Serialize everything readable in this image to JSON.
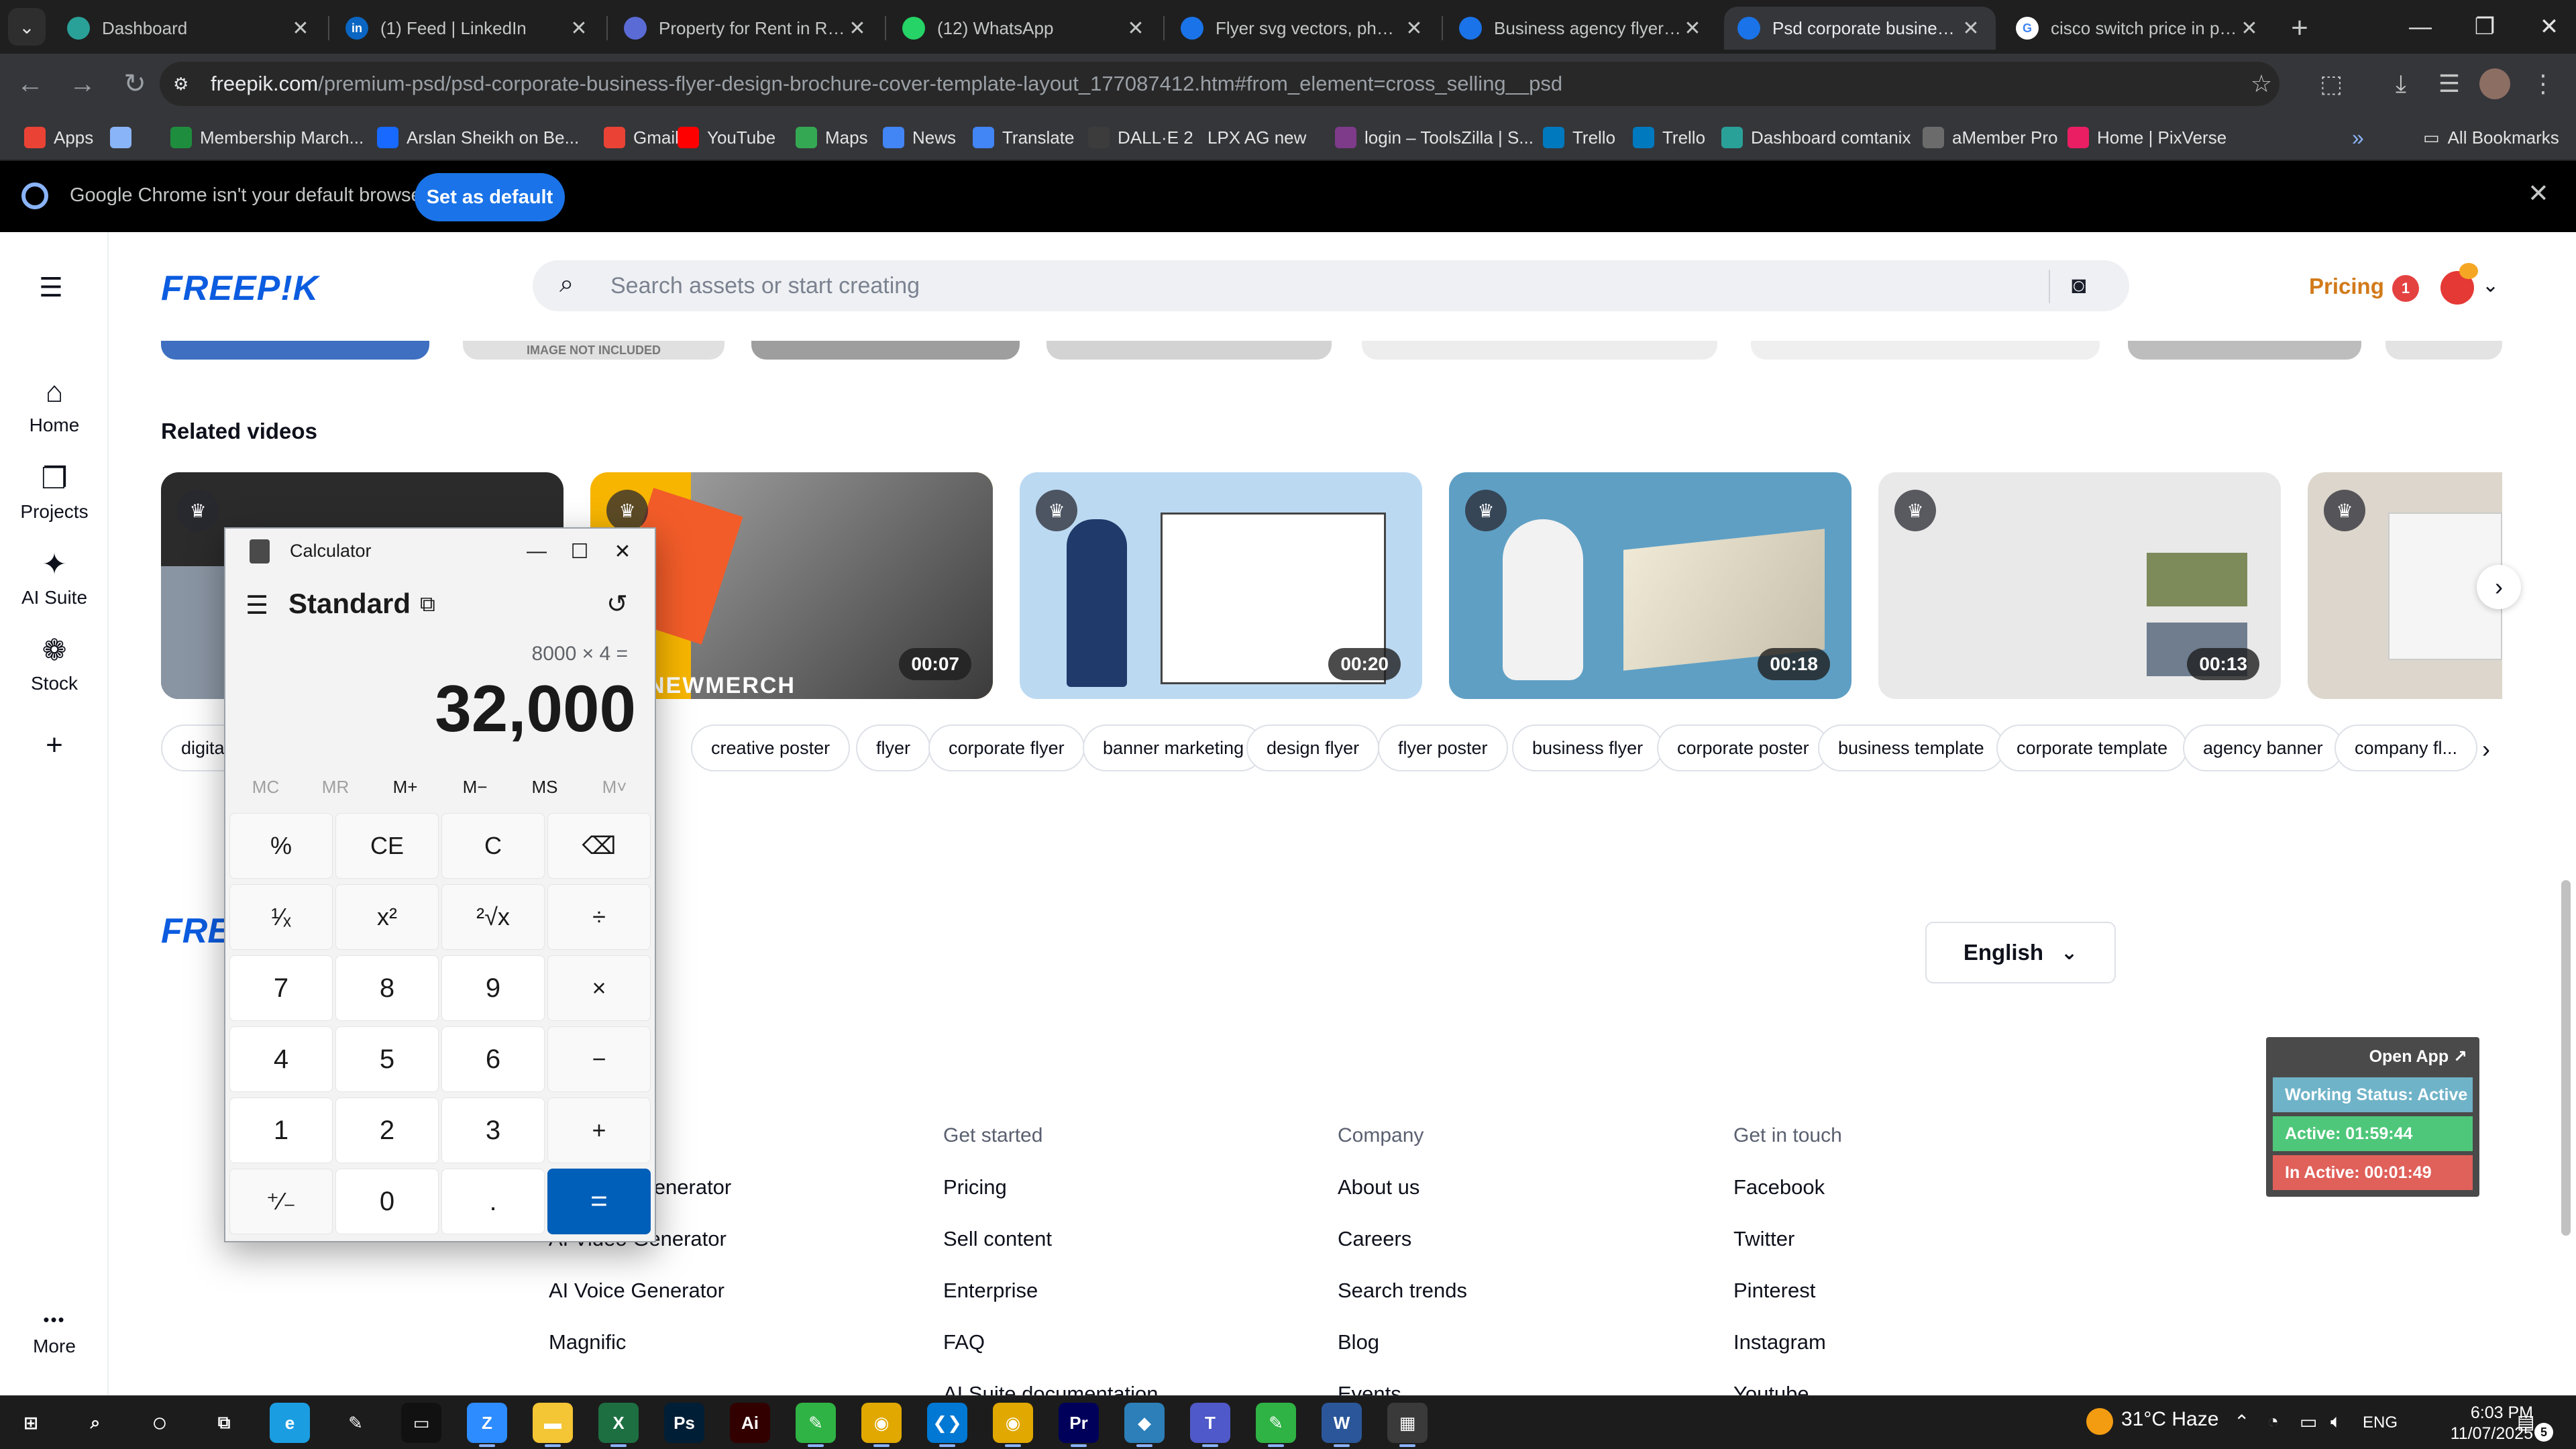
{
  "tabs": [
    {
      "title": "Dashboard",
      "favicon": "globe-icon",
      "color": "#2aa198",
      "active": false
    },
    {
      "title": "(1) Feed | LinkedIn",
      "favicon": "linkedin-icon",
      "color": "#0a66c2",
      "active": false
    },
    {
      "title": "Property for Rent in Rawa...",
      "favicon": "zameen-icon",
      "color": "#5b6bd6",
      "active": false
    },
    {
      "title": "(12) WhatsApp",
      "favicon": "whatsapp-icon",
      "color": "#25d366",
      "active": false
    },
    {
      "title": "Flyer svg vectors, photos ...",
      "favicon": "freepik-icon",
      "color": "#1a73e8",
      "active": false
    },
    {
      "title": "Business agency flyer | Pr...",
      "favicon": "freepik-icon",
      "color": "#1a73e8",
      "active": false
    },
    {
      "title": "Psd corporate business fl...",
      "favicon": "freepik-icon",
      "color": "#1a73e8",
      "active": true
    },
    {
      "title": "cisco switch price in paki...",
      "favicon": "google-icon",
      "color": "#ffffff",
      "active": false
    }
  ],
  "address": {
    "host": "freepik.com",
    "path": "/premium-psd/psd-corporate-business-flyer-design-brochure-cover-template-layout_177087412.htm#from_element=cross_selling__psd"
  },
  "bookmarks": [
    {
      "label": "Apps",
      "icon": "apps-grid-icon",
      "color": "#ea4335"
    },
    {
      "label": "",
      "icon": "tab-groups-icon",
      "color": "#8ab4f8"
    },
    {
      "label": "Membership March...",
      "icon": "green-plus-icon",
      "color": "#1e8e3e"
    },
    {
      "label": "Arslan Sheikh on Be...",
      "icon": "behance-icon",
      "color": "#1769ff"
    },
    {
      "label": "Gmail",
      "icon": "gmail-icon",
      "color": "#ea4335"
    },
    {
      "label": "YouTube",
      "icon": "youtube-icon",
      "color": "#ff0000"
    },
    {
      "label": "Maps",
      "icon": "maps-pin-icon",
      "color": "#34a853"
    },
    {
      "label": "News",
      "icon": "news-icon",
      "color": "#4285f4"
    },
    {
      "label": "Translate",
      "icon": "translate-icon",
      "color": "#4285f4"
    },
    {
      "label": "DALL·E 2",
      "icon": "openai-icon",
      "color": "#3c3c3c"
    },
    {
      "label": "LPX AG new",
      "icon": "",
      "color": "#35363a"
    },
    {
      "label": "login – ToolsZilla | S...",
      "icon": "toolszilla-icon",
      "color": "#7e3b8a"
    },
    {
      "label": "Trello",
      "icon": "trello-icon",
      "color": "#0079bf"
    },
    {
      "label": "Trello",
      "icon": "trello-icon",
      "color": "#0079bf"
    },
    {
      "label": "Dashboard comtanix",
      "icon": "comtanix-icon",
      "color": "#2aa198"
    },
    {
      "label": "aMember Pro",
      "icon": "amember-icon",
      "color": "#6b6b6b"
    },
    {
      "label": "Home | PixVerse",
      "icon": "pixverse-icon",
      "color": "#e91e63"
    }
  ],
  "all_bookmarks": "All Bookmarks",
  "infobar": {
    "message": "Google Chrome isn't your default browser",
    "button": "Set as default"
  },
  "freepik": {
    "logo": "FREEP!K",
    "search_placeholder": "Search assets or start creating",
    "pricing": "Pricing",
    "notifications": "1",
    "rail": [
      {
        "label": "Home",
        "icon": "home-icon"
      },
      {
        "label": "Projects",
        "icon": "projects-icon"
      },
      {
        "label": "AI Suite",
        "icon": "ai-suite-icon"
      },
      {
        "label": "Stock",
        "icon": "stock-icon"
      },
      {
        "label": "",
        "icon": "plus-icon"
      },
      {
        "label": "More",
        "icon": "more-dots-icon"
      }
    ],
    "strip_label": "IMAGE NOT INCLUDED",
    "related_title": "Related videos",
    "videos": [
      {
        "duration": "",
        "bg": "#2b2b2b"
      },
      {
        "duration": "00:07",
        "bg": "#f7b500",
        "caption": "NEWMERCH"
      },
      {
        "duration": "00:20",
        "bg": "#bcd9f2"
      },
      {
        "duration": "00:18",
        "bg": "#5f9fc4"
      },
      {
        "duration": "00:13",
        "bg": "#e9e9e9"
      },
      {
        "duration": "",
        "bg": "#dcd6cc"
      }
    ],
    "chips": [
      "digital",
      "flyer",
      "creative poster",
      "flyer",
      "corporate flyer",
      "banner marketing",
      "design flyer",
      "flyer poster",
      "business flyer",
      "corporate poster",
      "business template",
      "corporate template",
      "agency banner",
      "company fl..."
    ],
    "language": "English",
    "footer_columns": [
      {
        "heading": "",
        "items": [
          "AI Image Generator",
          "AI Video Generator",
          "AI Voice Generator",
          "Magnific"
        ]
      },
      {
        "heading": "Get started",
        "items": [
          "Pricing",
          "Sell content",
          "Enterprise",
          "FAQ",
          "AI Suite documentation"
        ]
      },
      {
        "heading": "Company",
        "items": [
          "About us",
          "Careers",
          "Search trends",
          "Blog",
          "Events"
        ]
      },
      {
        "heading": "Get in touch",
        "items": [
          "Facebook",
          "Twitter",
          "Pinterest",
          "Instagram",
          "Youtube"
        ]
      }
    ]
  },
  "calculator": {
    "title": "Calculator",
    "mode": "Standard",
    "expression": "8000 × 4 =",
    "result": "32,000",
    "memory": [
      "MC",
      "MR",
      "M+",
      "M−",
      "MS",
      "M˅"
    ],
    "keys": [
      [
        "%",
        "CE",
        "C",
        "⌫"
      ],
      [
        "¹⁄ₓ",
        "x²",
        "²√x",
        "÷"
      ],
      [
        "7",
        "8",
        "9",
        "×"
      ],
      [
        "4",
        "5",
        "6",
        "−"
      ],
      [
        "1",
        "2",
        "3",
        "+"
      ],
      [
        "⁺⁄₋",
        "0",
        ".",
        "="
      ]
    ]
  },
  "tracker": {
    "open_app": "Open App ↗",
    "rows": [
      {
        "text": "Working Status: Active",
        "color": "#6fb3c8"
      },
      {
        "text": "Active: 01:59:44",
        "color": "#4fc77a"
      },
      {
        "text": "In Active: 00:01:49",
        "color": "#e0605a"
      }
    ]
  },
  "taskbar": {
    "apps": [
      {
        "name": "start-icon",
        "glyph": "⊞",
        "color": "#1c1c1c"
      },
      {
        "name": "search-icon",
        "glyph": "⌕",
        "color": "#1c1c1c"
      },
      {
        "name": "cortana-icon",
        "glyph": "○",
        "color": "#1c1c1c"
      },
      {
        "name": "task-view-icon",
        "glyph": "⧉",
        "color": "#1c1c1c"
      },
      {
        "name": "edge-icon",
        "glyph": "e",
        "color": "#1b9de2"
      },
      {
        "name": "pen-icon",
        "glyph": "✎",
        "color": "#1c1c1c"
      },
      {
        "name": "terminal-icon",
        "glyph": "▭",
        "color": "#111111"
      },
      {
        "name": "zoom-icon",
        "glyph": "Z",
        "color": "#2d8cff"
      },
      {
        "name": "file-explorer-icon",
        "glyph": "▬",
        "color": "#f4c534"
      },
      {
        "name": "excel-icon",
        "glyph": "X",
        "color": "#1d6f42"
      },
      {
        "name": "photoshop-icon",
        "glyph": "Ps",
        "color": "#001e36"
      },
      {
        "name": "illustrator-icon",
        "glyph": "Ai",
        "color": "#330000"
      },
      {
        "name": "green-app-icon",
        "glyph": "✎",
        "color": "#2fb344"
      },
      {
        "name": "chrome-icon",
        "glyph": "◉",
        "color": "#e0a800"
      },
      {
        "name": "vscode-icon",
        "glyph": "❮❯",
        "color": "#0078d4"
      },
      {
        "name": "chrome-profile-icon",
        "glyph": "◉",
        "color": "#e0a800"
      },
      {
        "name": "premiere-icon",
        "glyph": "Pr",
        "color": "#00005b"
      },
      {
        "name": "blue-app-icon",
        "glyph": "◆",
        "color": "#2c7fb8"
      },
      {
        "name": "teams-icon",
        "glyph": "T",
        "color": "#5059c9"
      },
      {
        "name": "green-app-2-icon",
        "glyph": "✎",
        "color": "#2fb344"
      },
      {
        "name": "word-icon",
        "glyph": "W",
        "color": "#2b579a"
      },
      {
        "name": "calculator-icon",
        "glyph": "▦",
        "color": "#3a3a3a"
      }
    ],
    "weather": "31°C  Haze",
    "language": "ENG",
    "time": "6:03 PM",
    "date": "11/07/2025",
    "notification_count": "5"
  }
}
